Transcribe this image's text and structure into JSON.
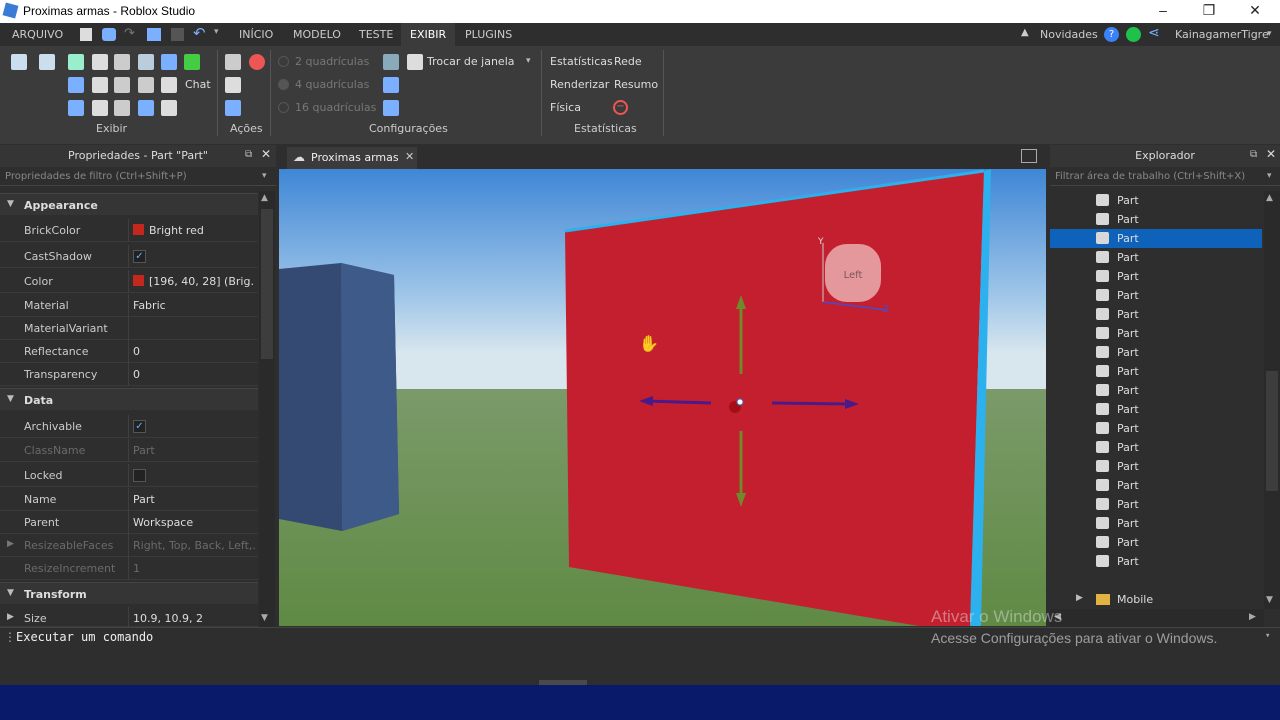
{
  "window": {
    "title": "Proximas armas - Roblox Studio",
    "minimize": "–",
    "maximize": "❐",
    "close": "✕"
  },
  "menu": {
    "arquivo": "ARQUIVO",
    "inicio": "INÍCIO",
    "modelo": "MODELO",
    "teste": "TESTE",
    "exibir": "EXIBIR",
    "plugins": "PLUGINS",
    "novidades": "Novidades",
    "username": "KainagamerTigre"
  },
  "ribbon": {
    "chat": "Chat",
    "group_exibir": "Exibir",
    "group_acoes": "Ações",
    "group_config": "Configurações",
    "group_estat": "Estatísticas",
    "quad2": "2 quadrículas",
    "quad4": "4 quadrículas",
    "quad16": "16 quadrículas",
    "trocar": "Trocar de janela",
    "estatisticas": "Estatísticas",
    "rede": "Rede",
    "renderizar": "Renderizar",
    "resumo": "Resumo",
    "fisica": "Física"
  },
  "properties": {
    "header": "Propriedades - Part \"Part\"",
    "filter_placeholder": "Propriedades de filtro (Ctrl+Shift+P)",
    "sections": {
      "appearance": "Appearance",
      "data": "Data",
      "transform": "Transform"
    },
    "rows": {
      "brickcolor": {
        "k": "BrickColor",
        "v": "Bright red"
      },
      "castshadow": {
        "k": "CastShadow"
      },
      "color": {
        "k": "Color",
        "v": "[196, 40, 28] (Brig..."
      },
      "material": {
        "k": "Material",
        "v": "Fabric"
      },
      "materialvariant": {
        "k": "MaterialVariant",
        "v": ""
      },
      "reflectance": {
        "k": "Reflectance",
        "v": "0"
      },
      "transparency": {
        "k": "Transparency",
        "v": "0"
      },
      "archivable": {
        "k": "Archivable"
      },
      "classname": {
        "k": "ClassName",
        "v": "Part"
      },
      "locked": {
        "k": "Locked"
      },
      "name": {
        "k": "Name",
        "v": "Part"
      },
      "parent": {
        "k": "Parent",
        "v": "Workspace"
      },
      "resizeablefaces": {
        "k": "ResizeableFaces",
        "v": "Right, Top, Back, Left,..."
      },
      "resizeincrement": {
        "k": "ResizeIncrement",
        "v": "1"
      },
      "size": {
        "k": "Size",
        "v": "10.9, 10.9, 2"
      }
    },
    "brick_color_hex": "#c4281c"
  },
  "tab": {
    "label": "Proximas armas"
  },
  "viewport": {
    "face_label": "Left",
    "axis_y": "Y",
    "axis_z": "Z"
  },
  "explorer": {
    "header": "Explorador",
    "filter_placeholder": "Filtrar área de trabalho (Ctrl+Shift+X)",
    "items": [
      "Part",
      "Part",
      "Part",
      "Part",
      "Part",
      "Part",
      "Part",
      "Part",
      "Part",
      "Part",
      "Part",
      "Part",
      "Part",
      "Part",
      "Part",
      "Part",
      "Part",
      "Part",
      "Part",
      "Part"
    ],
    "folder": "Mobile"
  },
  "command": {
    "placeholder": "Executar um comando"
  },
  "watermark": {
    "line1": "Ativar o Windows",
    "line2": "Acesse Configurações para ativar o Windows."
  }
}
